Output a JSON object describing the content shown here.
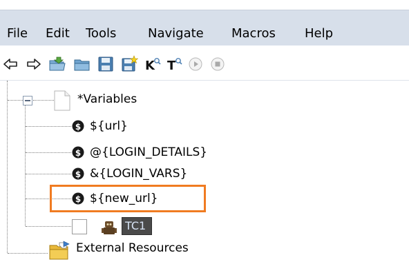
{
  "menu": [
    "File",
    "Edit",
    "Tools",
    "Navigate",
    "Macros",
    "Help"
  ],
  "toolbar": {
    "icons": [
      "back-arrow-icon",
      "forward-arrow-icon",
      "open-folder-icon",
      "folder-icon",
      "save-icon",
      "save-all-icon",
      "keyword-search-icon",
      "test-search-icon",
      "run-icon",
      "stop-icon"
    ]
  },
  "tree": {
    "root_label": "*Variables",
    "variables": [
      "${url}",
      "@{LOGIN_DETAILS}",
      "&{LOGIN_VARS}",
      "${new_url}"
    ],
    "testcase_label": "TC1",
    "external_label": "External Resources"
  },
  "colors": {
    "menubar_bg": "#d7dfea",
    "highlight": "#f07b21",
    "var_icon": "#1a1a1a"
  }
}
